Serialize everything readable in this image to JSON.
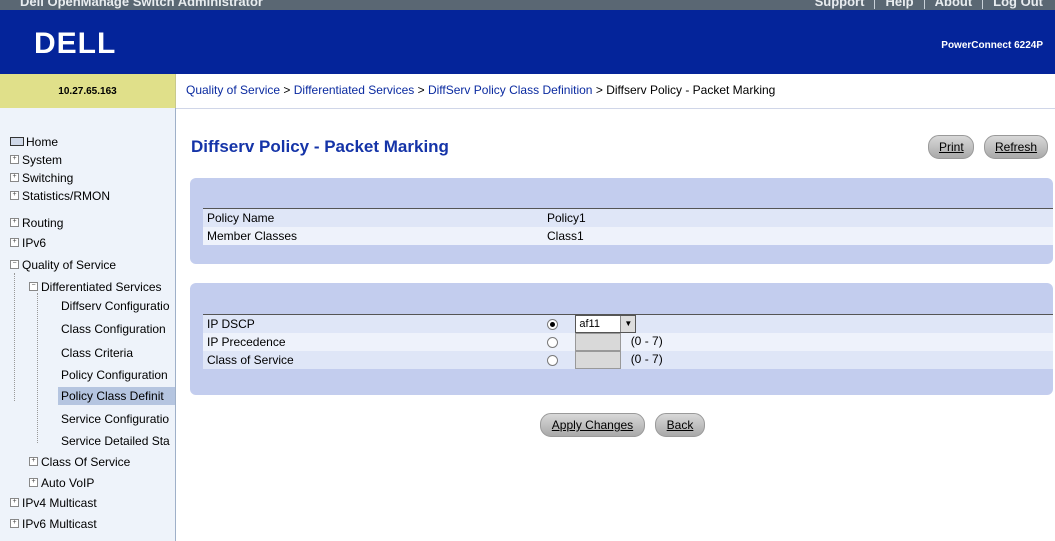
{
  "app": {
    "title": "Dell OpenManage Switch Administrator",
    "top_links": [
      "Support",
      "Help",
      "About",
      "Log Out"
    ],
    "logo_text": "DELL",
    "model": "PowerConnect 6224P",
    "ip": "10.27.65.163"
  },
  "breadcrumb": {
    "items": [
      "Quality of Service",
      "Differentiated Services",
      "DiffServ Policy Class Definition"
    ],
    "separator": ">",
    "current": "Diffserv Policy - Packet Marking"
  },
  "sidebar": {
    "items": [
      {
        "label": "Home"
      },
      {
        "label": "System"
      },
      {
        "label": "Switching"
      },
      {
        "label": "Statistics/RMON"
      },
      {
        "label": "Routing"
      },
      {
        "label": "IPv6"
      },
      {
        "label": "Quality of Service"
      },
      {
        "label": "Differentiated Services"
      },
      {
        "label": "Diffserv Configuratio"
      },
      {
        "label": "Class Configuration"
      },
      {
        "label": "Class Criteria"
      },
      {
        "label": "Policy Configuration"
      },
      {
        "label": "Policy Class Definit"
      },
      {
        "label": "Service Configuratio"
      },
      {
        "label": "Service Detailed Sta"
      },
      {
        "label": "Class Of Service"
      },
      {
        "label": "Auto VoIP"
      },
      {
        "label": "IPv4 Multicast"
      },
      {
        "label": "IPv6 Multicast"
      }
    ],
    "selected": "Policy Class Definit"
  },
  "page": {
    "title": "Diffserv Policy - Packet Marking",
    "print_label": "Print",
    "refresh_label": "Refresh"
  },
  "policy": {
    "rows": [
      {
        "label": "Policy Name",
        "value": "Policy1"
      },
      {
        "label": "Member Classes",
        "value": "Class1"
      }
    ]
  },
  "marking": {
    "ip_dscp": {
      "label": "IP DSCP",
      "selected": true,
      "value": "af11",
      "arrow": "▼"
    },
    "ip_precedence": {
      "label": "IP Precedence",
      "selected": false,
      "value": "",
      "range": "(0 - 7)"
    },
    "class_of_service": {
      "label": "Class of Service",
      "selected": false,
      "value": "",
      "range": "(0 - 7)"
    }
  },
  "actions": {
    "apply_label": "Apply Changes",
    "back_label": "Back"
  },
  "colors": {
    "banner": "#04249a",
    "title": "#1534a8",
    "panel": "#c3cdee",
    "ip_bg": "#e0e08a"
  }
}
